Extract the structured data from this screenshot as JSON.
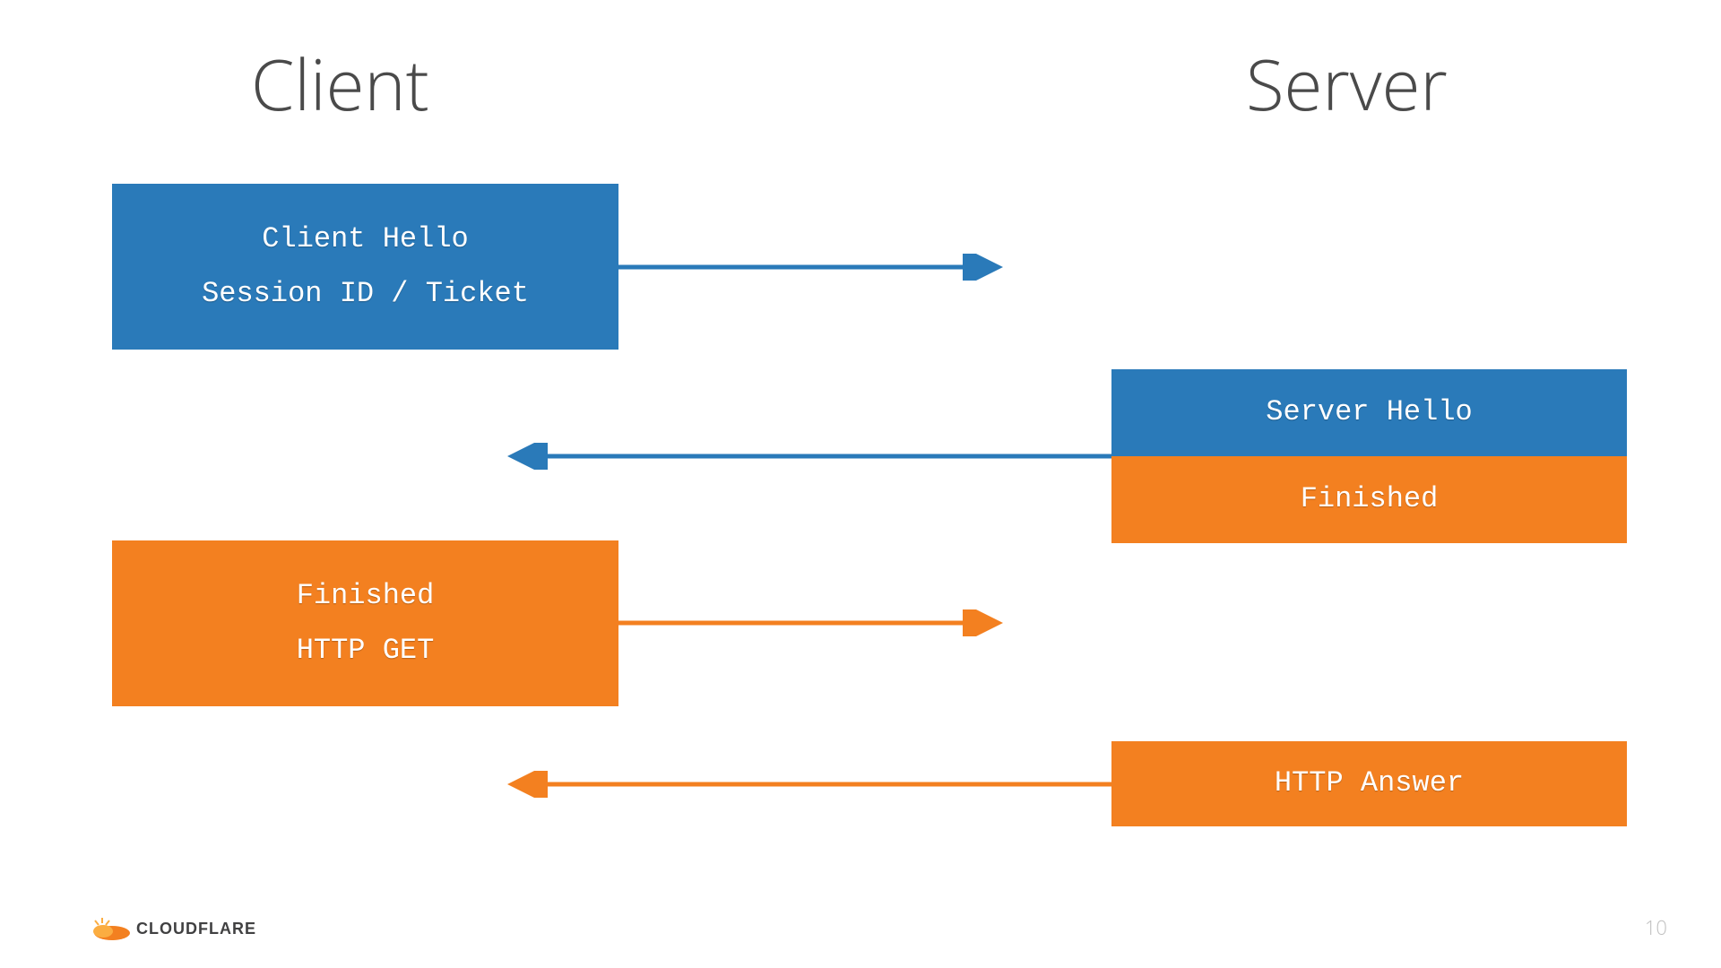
{
  "headings": {
    "client": "Client",
    "server": "Server"
  },
  "boxes": {
    "client_hello_l1": "Client Hello",
    "client_hello_l2": "Session ID / Ticket",
    "server_hello": "Server Hello",
    "server_finished": "Finished",
    "client_finished_l1": "Finished",
    "client_finished_l2": "HTTP GET",
    "http_answer": "HTTP Answer"
  },
  "colors": {
    "blue": "#2a7ab9",
    "orange": "#f38020"
  },
  "footer": {
    "brand": "CLOUDFLARE",
    "page": "10"
  }
}
